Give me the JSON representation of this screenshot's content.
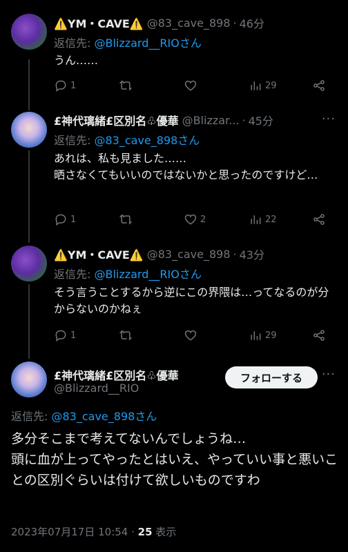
{
  "tweets": [
    {
      "name": "⚠️YM・CAVE⚠️",
      "handle": "@83_cave_898",
      "time": "46分",
      "reply_prefix": "返信先: ",
      "reply_to": "@Blizzard__RIOさん",
      "text": "うん……",
      "replies": "1",
      "retweets": "",
      "likes": "",
      "views": "29"
    },
    {
      "name": "£神代璃緒£区別名♧優華",
      "handle": "@Blizzar...",
      "time": "45分",
      "reply_prefix": "返信先: ",
      "reply_to": "@83_cave_898さん",
      "text": "あれは、私も見ました……\n晒さなくてもいいのではないかと思ったのですけど…",
      "replies": "1",
      "retweets": "",
      "likes": "2",
      "views": "22"
    },
    {
      "name": "⚠️YM・CAVE⚠️",
      "handle": "@83_cave_898",
      "time": "43分",
      "reply_prefix": "返信先: ",
      "reply_to": "@Blizzard__RIOさん",
      "text": "そう言うことするから逆にこの界隈は…ってなるのが分からないのかねぇ",
      "replies": "1",
      "retweets": "",
      "likes": "",
      "views": "29"
    }
  ],
  "main": {
    "name": "£神代璃緒£区別名♧優華",
    "handle": "@Blizzard__RIO",
    "follow_label": "フォローする",
    "reply_prefix": "返信先: ",
    "reply_to": "@83_cave_898さん",
    "text": "多分そこまで考えてないんでしょうね…\n頭に血が上ってやったとはいえ、やっていい事と悪いことの区別ぐらいは付けて欲しいものですわ",
    "datetime": "2023年07月17日 10:54",
    "views_count": "25",
    "views_label": " 表示"
  },
  "icons": [
    "reply-icon",
    "retweet-icon",
    "like-icon",
    "views-icon",
    "share-icon",
    "more-icon"
  ],
  "colors": {
    "background": "#000000",
    "link": "#1d9bf0",
    "muted": "#71767b",
    "text": "#e7e9ea"
  }
}
